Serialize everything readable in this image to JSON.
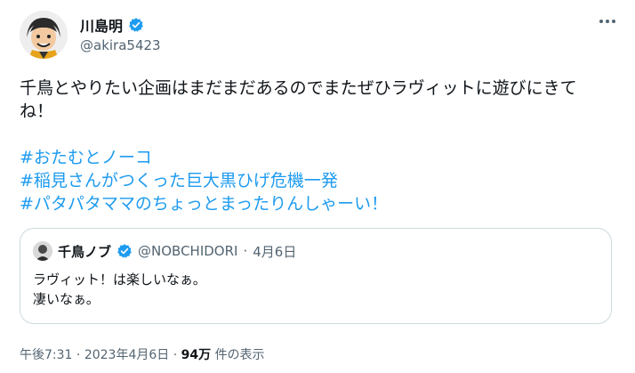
{
  "author": {
    "display_name": "川島明",
    "handle": "@akira5423",
    "verified_icon": "verified-badge-icon",
    "avatar_icon": "avatar-cartoon-man"
  },
  "tweet": {
    "lines": [
      "千鳥とやりたい企画はまだまだあるのでまたぜひラヴィットに遊びにきて",
      "ね！"
    ],
    "hashtags": [
      "#おたむとノーコ",
      "#稲見さんがつくった巨大黒ひげ危機一発",
      "#パタパタママのちょっとまったりんしゃーい！"
    ]
  },
  "quote": {
    "display_name": "千鳥ノブ",
    "handle": "@NOBCHIDORI",
    "separator": "·",
    "date": "4月6日",
    "lines": [
      "ラヴィット！は楽しいなぁ。",
      "凄いなぁ。"
    ]
  },
  "meta": {
    "time": "午後7:31",
    "sep1": "·",
    "date": "2023年4月6日",
    "sep2": "·",
    "views_count": "94万",
    "views_label": "件の表示"
  },
  "colors": {
    "accent": "#1d9bf0",
    "text": "#0f1419",
    "secondary": "#536471",
    "border": "#cfd9de"
  }
}
